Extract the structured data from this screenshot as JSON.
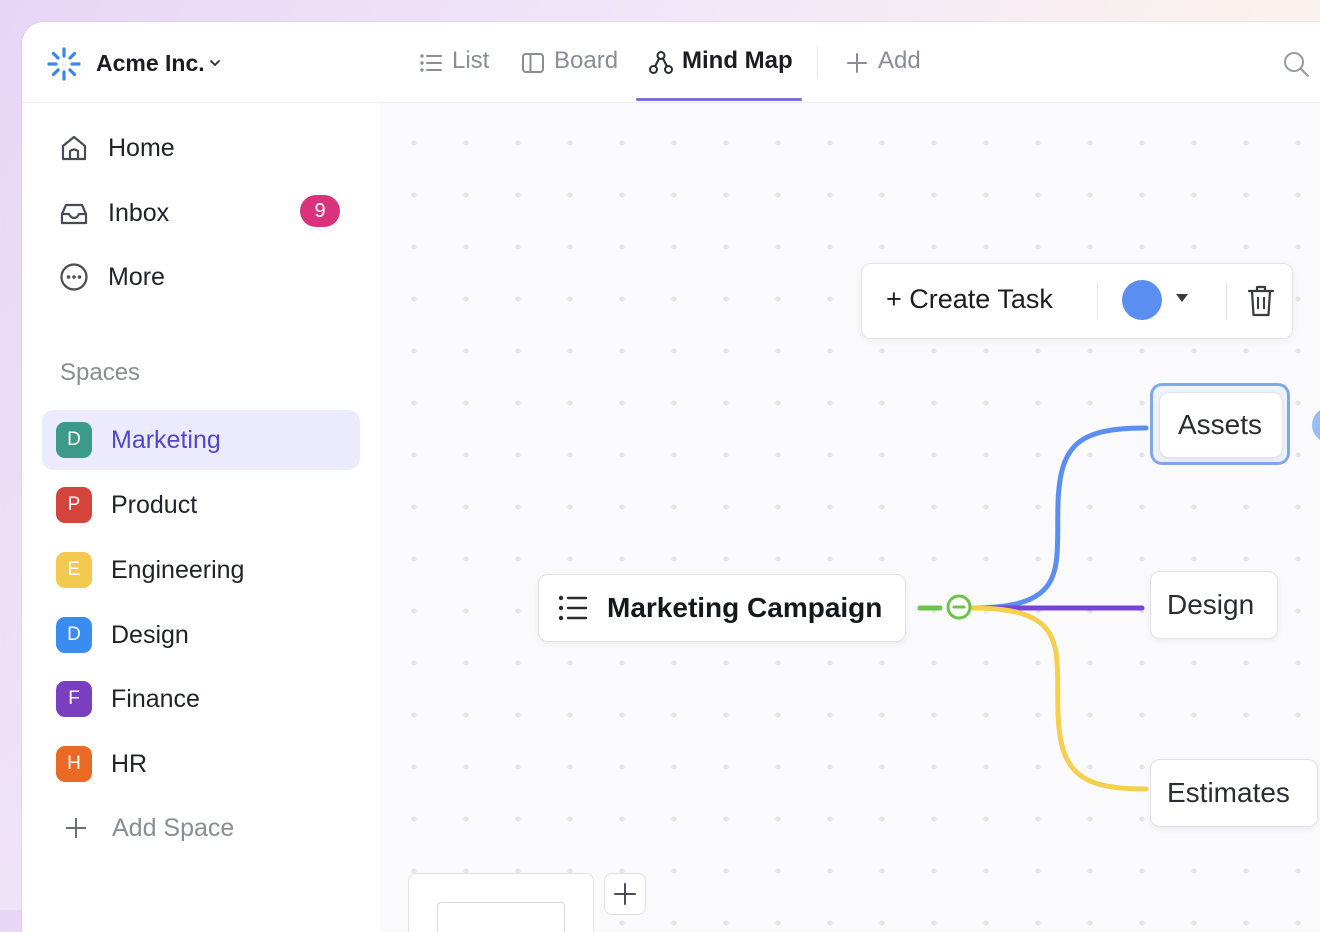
{
  "workspace": {
    "name": "Acme Inc.",
    "logo_icon": "sunburst-logo-icon",
    "brand_color": "#3b82f6"
  },
  "nav": {
    "items": [
      {
        "label": "Home",
        "icon": "home-icon"
      },
      {
        "label": "Inbox",
        "icon": "inbox-icon",
        "badge": "9"
      },
      {
        "label": "More",
        "icon": "more-circle-icon"
      }
    ]
  },
  "spaces": {
    "heading": "Spaces",
    "items": [
      {
        "initial": "D",
        "label": "Marketing",
        "color": "#3c9a8a",
        "active": true
      },
      {
        "initial": "P",
        "label": "Product",
        "color": "#d4443d"
      },
      {
        "initial": "E",
        "label": "Engineering",
        "color": "#f3c94f"
      },
      {
        "initial": "D",
        "label": "Design",
        "color": "#3b8cf1"
      },
      {
        "initial": "F",
        "label": "Finance",
        "color": "#7a3fbe"
      },
      {
        "initial": "H",
        "label": "HR",
        "color": "#ea6a25"
      }
    ],
    "add_label": "Add Space"
  },
  "views": {
    "tabs": [
      {
        "label": "List",
        "icon": "list-icon"
      },
      {
        "label": "Board",
        "icon": "board-icon"
      },
      {
        "label": "Mind Map",
        "icon": "mind-map-icon",
        "active": true
      }
    ],
    "add_label": "Add"
  },
  "toolbar": {
    "create_label": "+ Create Task",
    "selected_color": "#5b8ef1"
  },
  "mindmap": {
    "root": "Marketing Campaign",
    "children": [
      {
        "label": "Assets",
        "edge_color": "#5b8ef1",
        "selected": true
      },
      {
        "label": "Design",
        "edge_color": "#7a44d6"
      },
      {
        "label": "Estimates",
        "edge_color": "#f5d04f"
      }
    ],
    "root_edge_color": "#6cc24a"
  }
}
